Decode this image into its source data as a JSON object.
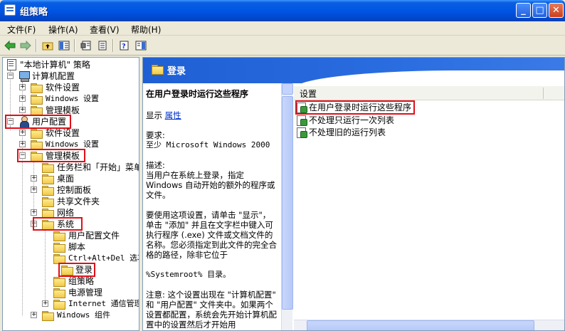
{
  "window": {
    "title": "组策略"
  },
  "menu": [
    {
      "label": "文件(F)"
    },
    {
      "label": "操作(A)"
    },
    {
      "label": "查看(V)"
    },
    {
      "label": "帮助(H)"
    }
  ],
  "tree": [
    {
      "label": "\"本地计算机\" 策略"
    },
    {
      "label": "计算机配置"
    },
    {
      "label": "软件设置"
    },
    {
      "label": "Windows 设置"
    },
    {
      "label": "管理模板"
    },
    {
      "label": "用户配置"
    },
    {
      "label": "软件设置"
    },
    {
      "label": "Windows 设置"
    },
    {
      "label": "管理模板"
    },
    {
      "label": "任务栏和「开始」菜单"
    },
    {
      "label": "桌面"
    },
    {
      "label": "控制面板"
    },
    {
      "label": "共享文件夹"
    },
    {
      "label": "网络"
    },
    {
      "label": "系统"
    },
    {
      "label": "用户配置文件"
    },
    {
      "label": "脚本"
    },
    {
      "label": "Ctrl+Alt+Del 选项"
    },
    {
      "label": "登录"
    },
    {
      "label": "组策略"
    },
    {
      "label": "电源管理"
    },
    {
      "label": "Internet 通信管理"
    },
    {
      "label": "Windows 组件"
    }
  ],
  "right": {
    "banner_title": "登录",
    "description": {
      "title": "在用户登录时运行这些程序",
      "show_prefix": "显示",
      "show_link": "属性",
      "requirements_label": "要求:",
      "requirements_value": "至少 Microsoft Windows 2000",
      "desc_label": "描述:",
      "desc_text": "当用户在系统上登录，指定 Windows 自动开始的额外的程序或文件。",
      "usage_text": "要使用这项设置，请单击 \"显示\"，单击 \"添加\" 并且在文字栏中键入可执行程序 (.exe) 文件或文档文件的名称。您必须指定到此文件的完全合格的路径，除非它位于",
      "usage_path": "%Systemroot% 目录。",
      "note_text": "注意: 这个设置出现在 \"计算机配置\" 和 \"用户配置\" 文件夹中。如果两个设置都配置，系统会先开始计算机配置中的设置然后才开始用"
    },
    "list_header": "设置",
    "settings": [
      {
        "label": "在用户登录时运行这些程序"
      },
      {
        "label": "不处理只运行一次列表"
      },
      {
        "label": "不处理旧的运行列表"
      }
    ]
  }
}
